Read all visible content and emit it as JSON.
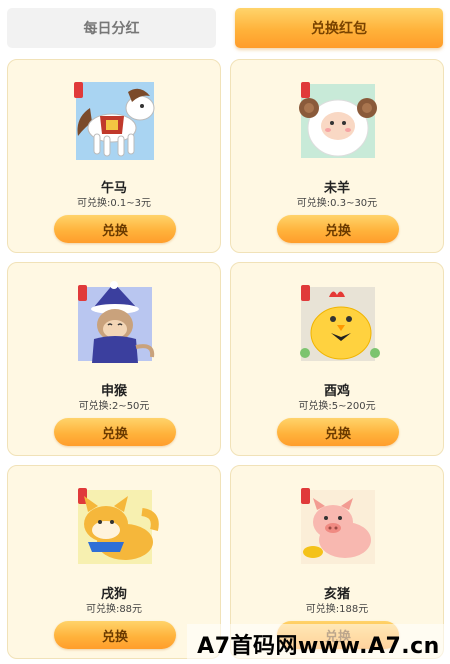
{
  "tabs": {
    "daily": "每日分红",
    "redeem": "兑换红包"
  },
  "cards": [
    {
      "name": "午马",
      "range": "可兑换:0.1~3元",
      "button": "兑换",
      "icon": "horse-zodiac-icon"
    },
    {
      "name": "未羊",
      "range": "可兑换:0.3~30元",
      "button": "兑换",
      "icon": "sheep-zodiac-icon"
    },
    {
      "name": "申猴",
      "range": "可兑换:2~50元",
      "button": "兑换",
      "icon": "monkey-zodiac-icon"
    },
    {
      "name": "酉鸡",
      "range": "可兑换:5~200元",
      "button": "兑换",
      "icon": "rooster-zodiac-icon"
    },
    {
      "name": "戌狗",
      "range": "可兑换:88元",
      "button": "兑换",
      "icon": "dog-zodiac-icon"
    },
    {
      "name": "亥猪",
      "range": "可兑换:188元",
      "button": "兑换",
      "icon": "pig-zodiac-icon"
    }
  ],
  "watermark": "A7首码网www.A7.cn",
  "colors": {
    "active_tab": "#ffb23a",
    "inactive_tab": "#f2f2f2",
    "card_bg": "#fff8e3",
    "button": "#ffb33c"
  }
}
